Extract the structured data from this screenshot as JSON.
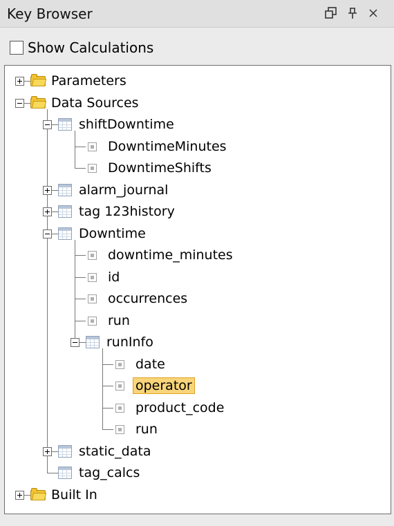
{
  "panel": {
    "title": "Key Browser",
    "icons": [
      "restore-window-icon",
      "pin-icon",
      "close-icon"
    ],
    "show_calculations": {
      "label": "Show Calculations",
      "checked": false
    }
  },
  "tree": [
    {
      "label": "Parameters",
      "icon": "folder-icon",
      "expanded": false
    },
    {
      "label": "Data Sources",
      "icon": "folder-icon",
      "expanded": true,
      "children": [
        {
          "label": "shiftDowntime",
          "icon": "table-icon",
          "expanded": true,
          "children": [
            {
              "label": "DowntimeMinutes",
              "icon": "field-icon"
            },
            {
              "label": "DowntimeShifts",
              "icon": "field-icon"
            }
          ]
        },
        {
          "label": "alarm_journal",
          "icon": "table-icon",
          "expanded": false
        },
        {
          "label": "tag 123history",
          "icon": "table-icon",
          "expanded": false
        },
        {
          "label": "Downtime",
          "icon": "table-icon",
          "expanded": true,
          "children": [
            {
              "label": "downtime_minutes",
              "icon": "field-icon"
            },
            {
              "label": "id",
              "icon": "field-icon"
            },
            {
              "label": "occurrences",
              "icon": "field-icon"
            },
            {
              "label": "run",
              "icon": "field-icon"
            },
            {
              "label": "runInfo",
              "icon": "table-icon",
              "expanded": true,
              "children": [
                {
                  "label": "date",
                  "icon": "field-icon"
                },
                {
                  "label": "operator",
                  "icon": "field-icon",
                  "selected": true
                },
                {
                  "label": "product_code",
                  "icon": "field-icon"
                },
                {
                  "label": "run",
                  "icon": "field-icon"
                }
              ]
            }
          ]
        },
        {
          "label": "static_data",
          "icon": "table-icon",
          "expanded": false
        },
        {
          "label": "tag_calcs",
          "icon": "table-icon",
          "leaf": true
        }
      ]
    },
    {
      "label": "Built In",
      "icon": "folder-icon",
      "expanded": false
    }
  ],
  "colors": {
    "selection_fill": "#f8d57a",
    "selection_border": "#e0a020",
    "folder": "#f2c230"
  }
}
